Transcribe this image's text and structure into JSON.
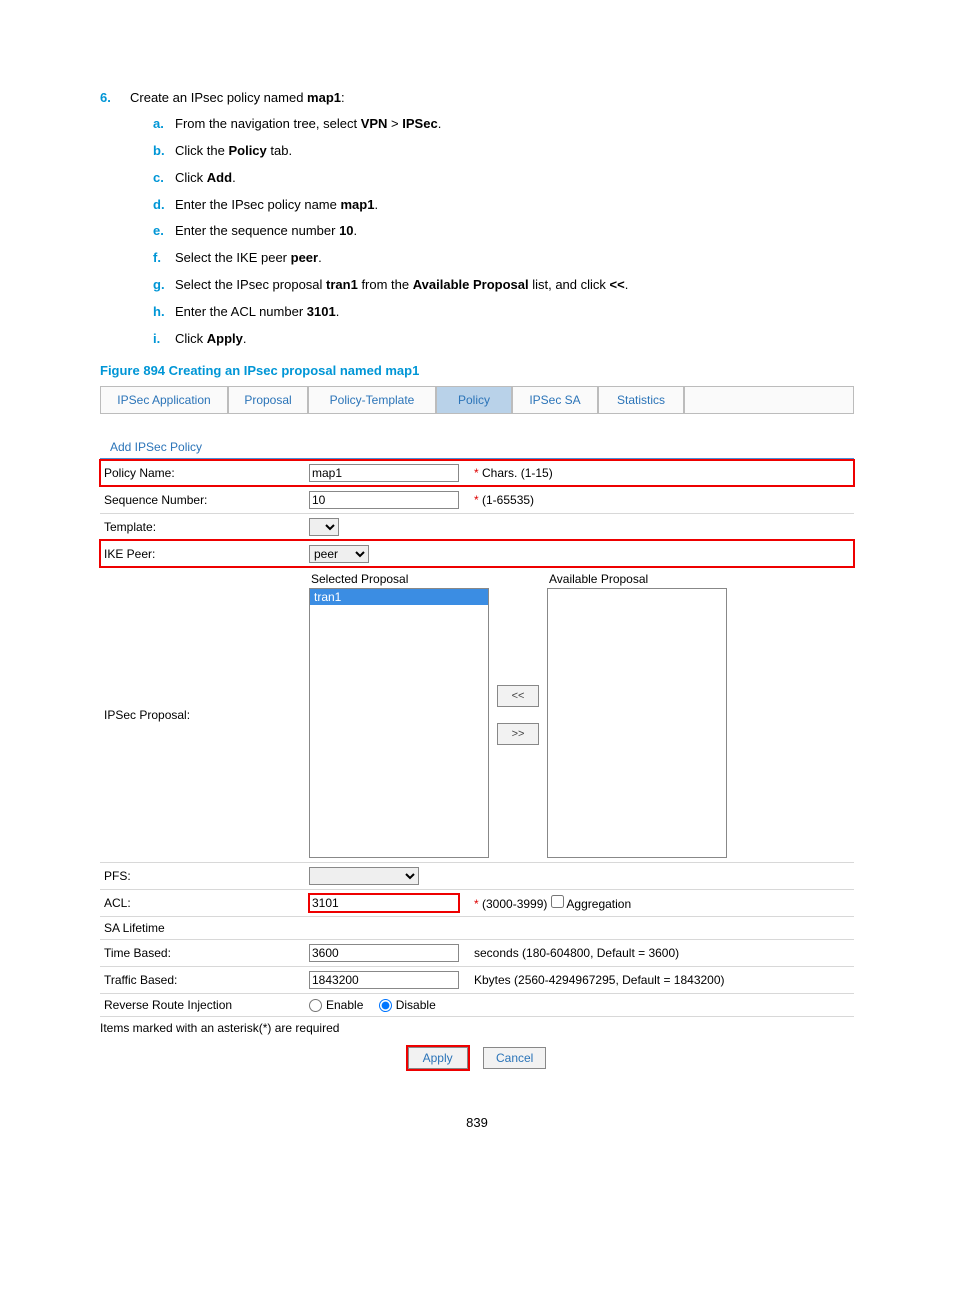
{
  "step": {
    "num": "6.",
    "text_pre": "Create an IPsec policy named ",
    "text_bold": "map1",
    "text_post": ":"
  },
  "subs": {
    "a": {
      "l": "a.",
      "pre": "From the navigation tree, select ",
      "b1": "VPN",
      "mid": " > ",
      "b2": "IPSec",
      "post": "."
    },
    "b": {
      "l": "b.",
      "pre": "Click the ",
      "b1": "Policy",
      "post": " tab."
    },
    "c": {
      "l": "c.",
      "pre": "Click ",
      "b1": "Add",
      "post": "."
    },
    "d": {
      "l": "d.",
      "pre": "Enter the IPsec policy name ",
      "b1": "map1",
      "post": "."
    },
    "e": {
      "l": "e.",
      "pre": "Enter the sequence number ",
      "b1": "10",
      "post": "."
    },
    "f": {
      "l": "f.",
      "pre": "Select the IKE peer ",
      "b1": "peer",
      "post": "."
    },
    "g": {
      "l": "g.",
      "pre": "Select the IPsec proposal ",
      "b1": "tran1",
      "mid": " from the ",
      "b2": "Available Proposal",
      "mid2": " list, and click ",
      "b3": "<<",
      "post": "."
    },
    "h": {
      "l": "h.",
      "pre": "Enter the ACL number ",
      "b1": "3101",
      "post": "."
    },
    "i": {
      "l": "i.",
      "pre": "Click ",
      "b1": "Apply",
      "post": "."
    }
  },
  "figure_caption": "Figure 894 Creating an IPsec proposal named map1",
  "tabs": {
    "app": "IPSec Application",
    "prop": "Proposal",
    "pt": "Policy-Template",
    "pol": "Policy",
    "sa": "IPSec SA",
    "stat": "Statistics"
  },
  "section_title": "Add IPSec Policy",
  "form": {
    "policy_name_label": "Policy Name:",
    "policy_name_value": "map1",
    "policy_name_hint": "Chars. (1-15)",
    "seq_label": "Sequence Number:",
    "seq_value": "10",
    "seq_hint": "(1-65535)",
    "template_label": "Template:",
    "ike_label": "IKE Peer:",
    "ike_value": "peer",
    "ipsec_prop_label": "IPSec Proposal:",
    "selected_head": "Selected Proposal",
    "selected_item": "tran1",
    "available_head": "Available Proposal",
    "move_left": "<<",
    "move_right": ">>",
    "pfs_label": "PFS:",
    "acl_label": "ACL:",
    "acl_value": "3101",
    "acl_hint": "(3000-3999)",
    "aggregation_label": "Aggregation",
    "sa_label": "SA Lifetime",
    "time_label": "Time Based:",
    "time_value": "3600",
    "time_hint": "seconds (180-604800, Default = 3600)",
    "traffic_label": "Traffic Based:",
    "traffic_value": "1843200",
    "traffic_hint": "Kbytes (2560-4294967295, Default = 1843200)",
    "rri_label": "Reverse Route Injection",
    "enable": "Enable",
    "disable": "Disable"
  },
  "footnote": "Items marked with an asterisk(*) are required",
  "buttons": {
    "apply": "Apply",
    "cancel": "Cancel"
  },
  "star": "* ",
  "page_num": "839"
}
